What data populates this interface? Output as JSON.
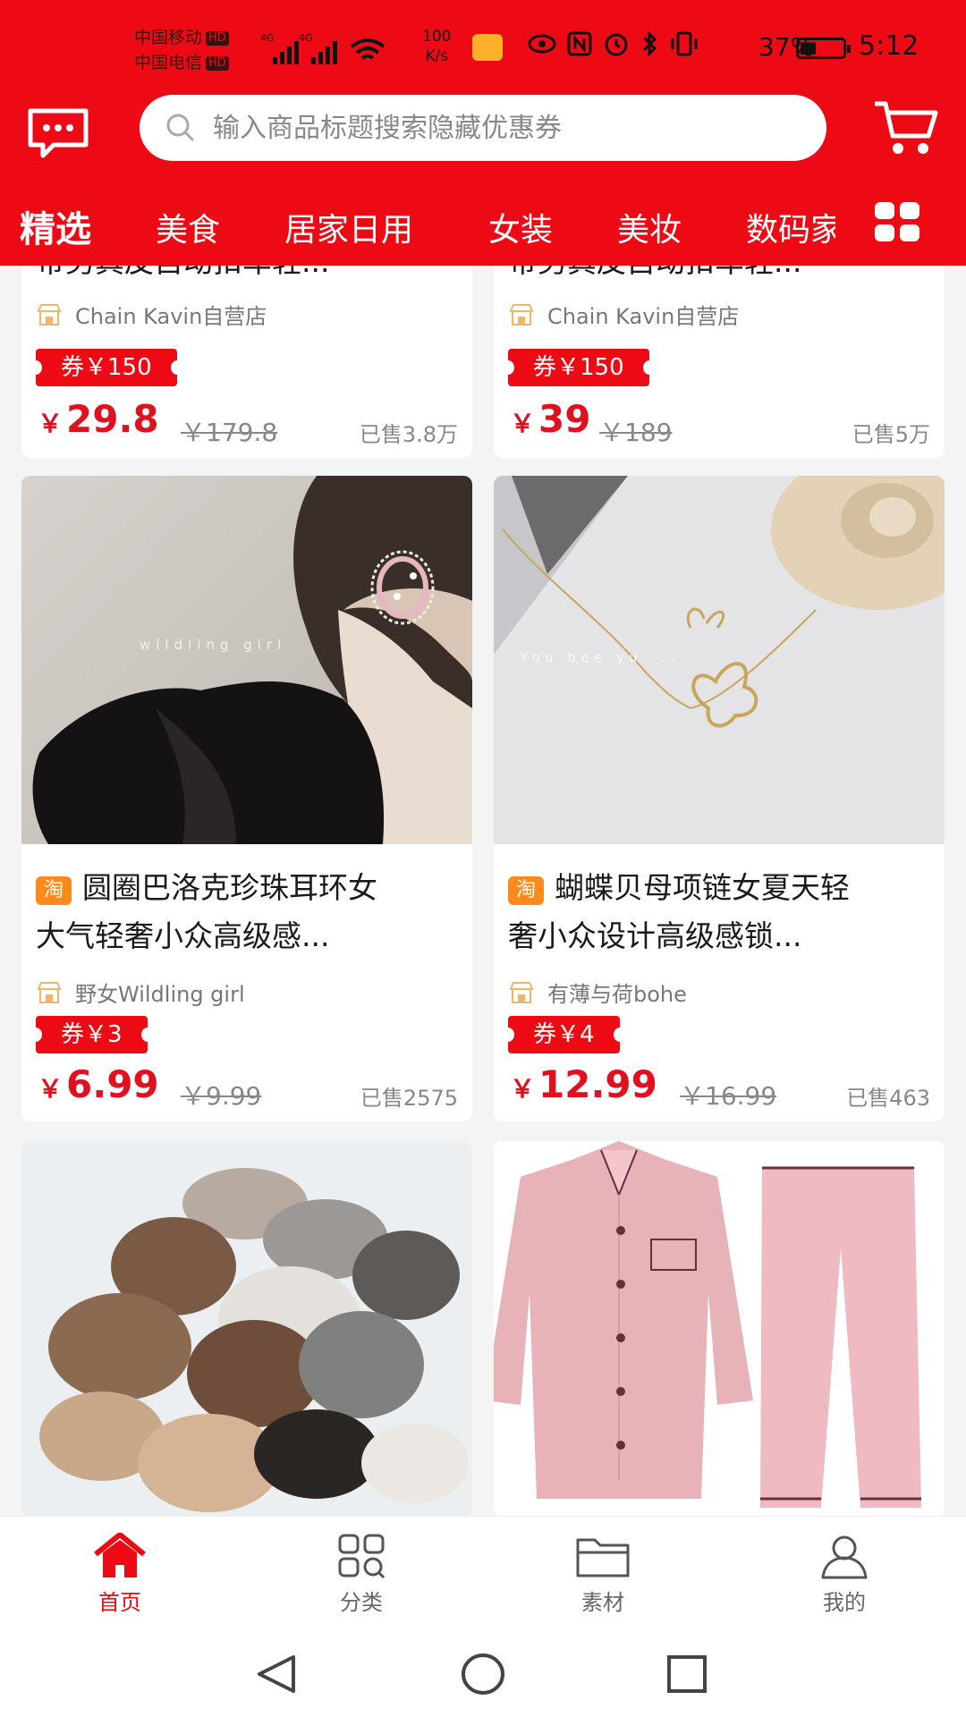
{
  "status_bar": {
    "carrier1": "中国移动",
    "carrier2": "中国电信",
    "hd": "HD",
    "net1": "4G",
    "net2": "4G",
    "speed_value": "100",
    "speed_unit": "K/s",
    "battery": "37%",
    "battery_level": 0.37,
    "time": "5:12"
  },
  "header": {
    "search_placeholder": "输入商品标题搜索隐藏优惠券"
  },
  "categories": [
    "精选",
    "美食",
    "居家日用",
    "女装",
    "美妆",
    "数码家"
  ],
  "active_category": "精选",
  "top_cards": [
    {
      "title": "带男真皮自动扣车轻...",
      "shop": "Chain Kavin自营店",
      "coupon": "券￥150",
      "currency": "￥",
      "price": "29.8",
      "original": "￥179.8",
      "sold": "已售3.8万"
    },
    {
      "title": "带男真皮自动扣车轻...",
      "shop": "Chain Kavin自营店",
      "coupon": "券￥150",
      "currency": "￥",
      "price": "39",
      "original": "￥189",
      "sold": "已售5万"
    }
  ],
  "cards": [
    {
      "badge": "淘",
      "title_line1": "圆圈巴洛克珍珠耳环女",
      "title_line2": "大气轻奢小众高级感...",
      "shop": "野女Wildling girl",
      "coupon": "券￥3",
      "currency": "￥",
      "price": "6.99",
      "original": "￥9.99",
      "sold": "已售2575",
      "image_text": "wildling girl"
    },
    {
      "badge": "淘",
      "title_line1": "蝴蝶贝母项链女夏天轻",
      "title_line2": "奢小众设计高级感锁...",
      "shop": "有薄与荷bohe",
      "coupon": "券￥4",
      "currency": "￥",
      "price": "12.99",
      "original": "￥16.99",
      "sold": "已售463",
      "image_text": "You bee yu ..."
    }
  ],
  "bottom_nav": [
    {
      "label": "首页",
      "icon": "home-icon",
      "active": true
    },
    {
      "label": "分类",
      "icon": "category-icon",
      "active": false
    },
    {
      "label": "素材",
      "icon": "folder-icon",
      "active": false
    },
    {
      "label": "我的",
      "icon": "profile-icon",
      "active": false
    }
  ],
  "colors": {
    "brand_red": "#ee0a14",
    "price_red": "#e0101e",
    "coupon_orange": "#ff8a1c"
  }
}
